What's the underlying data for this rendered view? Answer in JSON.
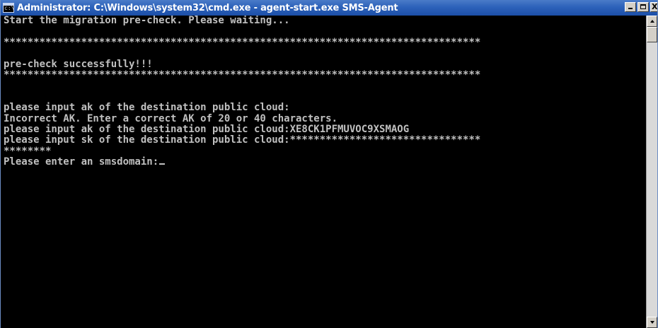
{
  "window": {
    "title": "Administrator: C:\\Windows\\system32\\cmd.exe - agent-start.exe  SMS-Agent",
    "icon_text": "c:\\",
    "close_glyph": "X"
  },
  "console": {
    "lines": [
      "Start the migration pre-check. Please waiting...",
      "",
      "********************************************************************************",
      "",
      "pre-check successfully!!!",
      "********************************************************************************",
      "",
      "",
      "please input ak of the destination public cloud:",
      "Incorrect AK. Enter a correct AK of 20 or 40 characters.",
      "please input ak of the destination public cloud:XE8CK1PFMUVOC9XSMAOG",
      "please input sk of the destination public cloud:********************************",
      "********",
      "Please enter an smsdomain:"
    ]
  },
  "colors": {
    "console_bg": "#000000",
    "console_fg": "#c0c0c0",
    "titlebar": "#2d62ba"
  },
  "icons": [
    "cmd-icon",
    "minimize-icon",
    "maximize-icon",
    "close-icon",
    "scroll-up-icon",
    "scroll-down-icon"
  ]
}
